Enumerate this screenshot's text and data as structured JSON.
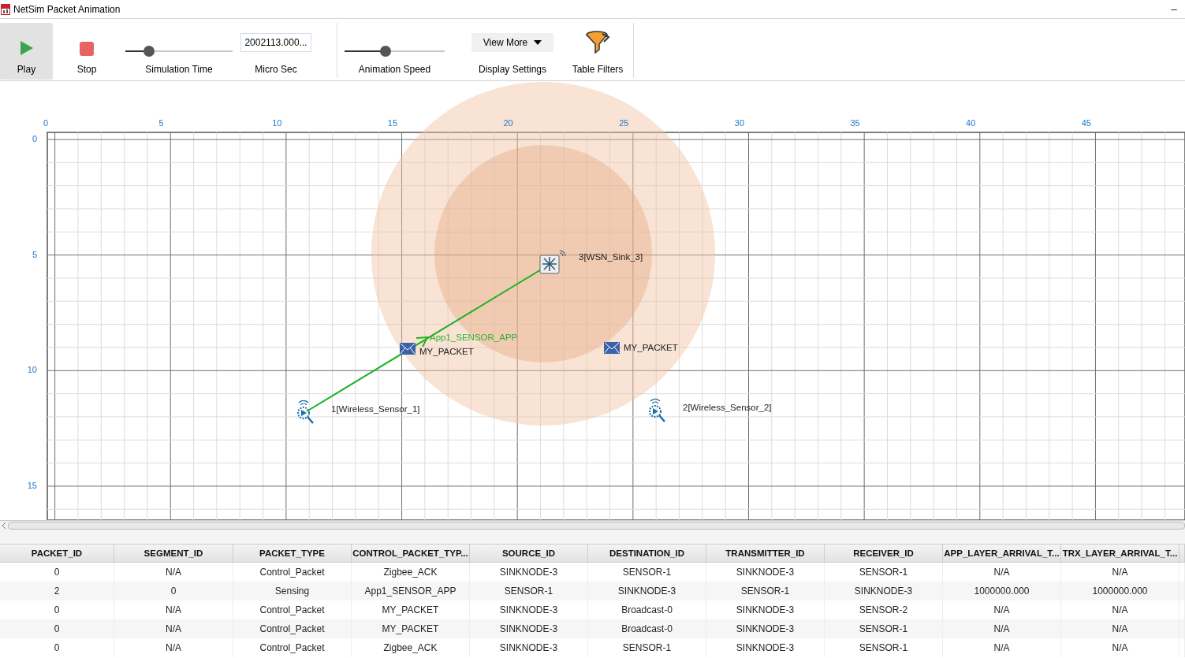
{
  "window": {
    "title": "NetSim Packet Animation",
    "minimize": "–"
  },
  "toolbar": {
    "play": {
      "label": "Play",
      "selected": true
    },
    "stop": {
      "label": "Stop",
      "selected": false
    },
    "simulation_time": {
      "label": "Simulation Time",
      "level": 0.22
    },
    "time_field": {
      "value": "2002113.000...",
      "label": "Micro Sec"
    },
    "animation_speed": {
      "label": "Animation Speed",
      "level": 0.41
    },
    "display_settings": {
      "button": "View More",
      "label": "Display Settings"
    },
    "table_filters": {
      "label": "Table Filters"
    }
  },
  "canvas": {
    "x_ticks": [
      "0",
      "5",
      "10",
      "15",
      "20",
      "25",
      "30",
      "35",
      "40",
      "45"
    ],
    "y_ticks": [
      "0",
      "5",
      "10",
      "15"
    ],
    "nodes": [
      {
        "kind": "sink",
        "label": "3[WSN_Sink_3]"
      },
      {
        "kind": "sensor",
        "label": "1[Wireless_Sensor_1]"
      },
      {
        "kind": "sensor",
        "label": "2[Wireless_Sensor_2]"
      }
    ],
    "link_label": "App1_SENSOR_APP",
    "packets": [
      {
        "label": "MY_PACKET"
      },
      {
        "label": "MY_PACKET"
      }
    ]
  },
  "table": {
    "columns": [
      "PACKET_ID",
      "SEGMENT_ID",
      "PACKET_TYPE",
      "CONTROL_PACKET_TYP...",
      "SOURCE_ID",
      "DESTINATION_ID",
      "TRANSMITTER_ID",
      "RECEIVER_ID",
      "APP_LAYER_ARRIVAL_T...",
      "TRX_LAYER_ARRIVAL_T..."
    ],
    "rows": [
      [
        "0",
        "N/A",
        "Control_Packet",
        "Zigbee_ACK",
        "SINKNODE-3",
        "SENSOR-1",
        "SINKNODE-3",
        "SENSOR-1",
        "N/A",
        "N/A"
      ],
      [
        "2",
        "0",
        "Sensing",
        "App1_SENSOR_APP",
        "SENSOR-1",
        "SINKNODE-3",
        "SENSOR-1",
        "SINKNODE-3",
        "1000000.000",
        "1000000.000"
      ],
      [
        "0",
        "N/A",
        "Control_Packet",
        "MY_PACKET",
        "SINKNODE-3",
        "Broadcast-0",
        "SINKNODE-3",
        "SENSOR-2",
        "N/A",
        "N/A"
      ],
      [
        "0",
        "N/A",
        "Control_Packet",
        "MY_PACKET",
        "SINKNODE-3",
        "Broadcast-0",
        "SINKNODE-3",
        "SENSOR-1",
        "N/A",
        "N/A"
      ],
      [
        "0",
        "N/A",
        "Control_Packet",
        "Zigbee_ACK",
        "SINKNODE-3",
        "SENSOR-1",
        "SINKNODE-3",
        "SENSOR-1",
        "N/A",
        "N/A"
      ]
    ]
  }
}
